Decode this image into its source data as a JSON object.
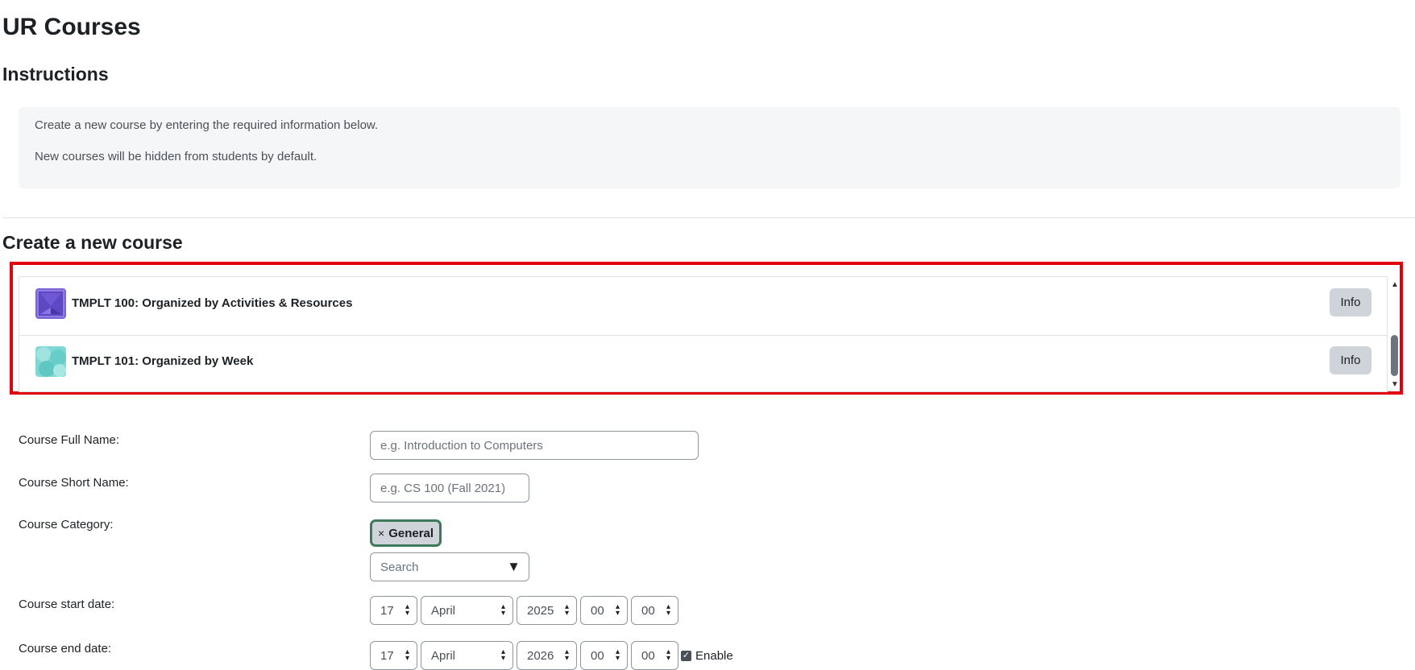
{
  "page": {
    "title": "UR Courses",
    "instructions_heading": "Instructions",
    "instructions": [
      "Create a new course by entering the required information below.",
      "New courses will be hidden from students by default."
    ],
    "create_heading": "Create a new course"
  },
  "templates": {
    "items": [
      {
        "name": "TMPLT 100: Organized by Activities & Resources",
        "icon": "course-template-purple-icon",
        "info_label": "Info"
      },
      {
        "name": "TMPLT 101: Organized by Week",
        "icon": "course-template-teal-icon",
        "info_label": "Info"
      }
    ],
    "highlight_color": "#e0000e"
  },
  "form": {
    "full_name": {
      "label": "Course Full Name:",
      "placeholder": "e.g. Introduction to Computers",
      "value": ""
    },
    "short_name": {
      "label": "Course Short Name:",
      "placeholder": "e.g. CS 100 (Fall 2021)",
      "value": ""
    },
    "category": {
      "label": "Course Category:",
      "selected_remove": "×",
      "selected": "General",
      "search_placeholder": "Search",
      "dropdown_arrow": "▼"
    },
    "start_date": {
      "label": "Course start date:",
      "day": "17",
      "month": "April",
      "year": "2025",
      "hour": "00",
      "minute": "00"
    },
    "end_date": {
      "label": "Course end date:",
      "day": "17",
      "month": "April",
      "year": "2026",
      "hour": "00",
      "minute": "00",
      "enable_label": "Enable",
      "enabled": true
    }
  },
  "colors": {
    "chip_border": "#3c7a5a",
    "info_button_bg": "#ced4da"
  }
}
